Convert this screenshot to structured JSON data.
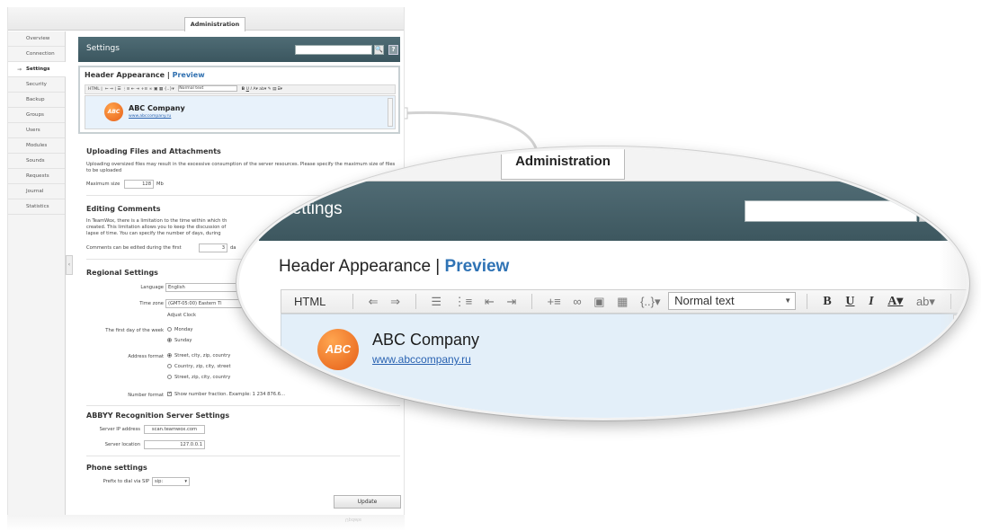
{
  "admin_tab": "Administration",
  "sidebar": {
    "items": [
      {
        "label": "Overview"
      },
      {
        "label": "Connection"
      },
      {
        "label": "Settings",
        "active": true
      },
      {
        "label": "Security"
      },
      {
        "label": "Backup"
      },
      {
        "label": "Groups"
      },
      {
        "label": "Users"
      },
      {
        "label": "Modules"
      },
      {
        "label": "Sounds"
      },
      {
        "label": "Requests"
      },
      {
        "label": "Journal"
      },
      {
        "label": "Statistics"
      }
    ],
    "active_arrow": "→",
    "collapse_glyph": "‹"
  },
  "header": {
    "title": "Settings",
    "search_icon": "search-icon",
    "search_glyph": "🔍",
    "help_glyph": "?"
  },
  "header_appearance": {
    "title": "Header Appearance",
    "separator": " | ",
    "preview": "Preview",
    "toolbar": {
      "html": "HTML",
      "undo": "⇐",
      "redo": "⇒",
      "groups": [
        "☰",
        "⋮≡",
        "⇤",
        "⇥",
        "+≡",
        "∞",
        "▣",
        "▦",
        "{..}▾"
      ],
      "style_select": "Normal text",
      "bold": "B",
      "underline": "U",
      "italic": "I",
      "font_color": "A▾",
      "highlight": "ab▾",
      "extras": [
        "✎",
        "▤",
        "⌸▾"
      ]
    },
    "company_name": "ABC Company",
    "company_url": "www.abccompany.ru",
    "logo_text": "ABC"
  },
  "uploading": {
    "title": "Uploading Files and Attachments",
    "description": "Uploading oversized files may result in the excessive consumption of the server resources. Please specify the maximum size of files to be uploaded",
    "max_size_label": "Maximum size",
    "max_size_value": "128",
    "max_size_unit": "Mb"
  },
  "editing": {
    "title": "Editing Comments",
    "description_lines": [
      "In TeamWox, there is a limitation to the time within which th",
      "created. This limitation allows you to keep the discussion of",
      "lapse of time. You can specify the number of days, during"
    ],
    "edit_label": "Comments can be edited during the first",
    "edit_value": "3",
    "edit_unit": "da"
  },
  "regional": {
    "title": "Regional Settings",
    "language_label": "Language",
    "language_value": "English",
    "timezone_label": "Time zone",
    "timezone_value": "(GMT-05:00) Eastern Ti",
    "adjust_clock": "Adjust Clock",
    "first_day_label": "The first day of the week",
    "first_day_options": [
      "Monday",
      "Sunday"
    ],
    "first_day_selected": 1,
    "address_label": "Address format",
    "address_options": [
      "Street, city, zip, country",
      "Country, zip, city, street",
      "Street, zip, city, country"
    ],
    "address_selected": 0,
    "number_label": "Number format",
    "number_text": "Show number fraction. Example: 1 234 876.6..."
  },
  "abbyy": {
    "title": "ABBYY Recognition Server Settings",
    "ip_label": "Server IP address",
    "ip_value": "scan.teamwox.com",
    "location_label": "Server location",
    "location_value": "127.0.0.1"
  },
  "phone": {
    "title": "Phone settings",
    "prefix_label": "Prefix to dial via SIP",
    "prefix_value": "sip:"
  },
  "update_button": "Update",
  "colors": {
    "header_bg": "#44606a",
    "accent_link": "#2f73b5",
    "logo_orange": "#e7621b",
    "editor_bg": "#e3eff9"
  }
}
